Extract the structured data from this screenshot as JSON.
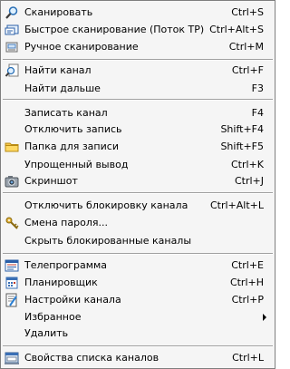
{
  "menu": {
    "scan": {
      "label": "Сканировать",
      "shortcut": "Ctrl+S",
      "icon": "magnifier-icon"
    },
    "quick_scan": {
      "label": "Быстрое сканирование (Поток ТР)",
      "shortcut": "Ctrl+Alt+S",
      "icon": "quick-scan-icon"
    },
    "manual_scan": {
      "label": "Ручное сканирование",
      "shortcut": "Ctrl+M",
      "icon": "manual-scan-icon"
    },
    "find_channel": {
      "label": "Найти канал",
      "shortcut": "Ctrl+F",
      "icon": "find-channel-icon"
    },
    "find_next": {
      "label": "Найти дальше",
      "shortcut": "F3"
    },
    "record_channel": {
      "label": "Записать канал",
      "shortcut": "F4"
    },
    "stop_record": {
      "label": "Отключить запись",
      "shortcut": "Shift+F4"
    },
    "record_folder": {
      "label": "Папка для записи",
      "shortcut": "Shift+F5",
      "icon": "folder-icon"
    },
    "simple_output": {
      "label": "Упрощенный вывод",
      "shortcut": "Ctrl+K"
    },
    "screenshot": {
      "label": "Скриншот",
      "shortcut": "Ctrl+J",
      "icon": "camera-icon"
    },
    "disable_lock": {
      "label": "Отключить блокировку канала",
      "shortcut": "Ctrl+Alt+L"
    },
    "change_password": {
      "label": "Смена пароля...",
      "icon": "keys-icon"
    },
    "hide_blocked": {
      "label": "Скрыть блокированные каналы"
    },
    "tv_program": {
      "label": "Телепрограмма",
      "shortcut": "Ctrl+E",
      "icon": "tv-program-icon"
    },
    "scheduler": {
      "label": "Планировщик",
      "shortcut": "Ctrl+H",
      "icon": "scheduler-icon"
    },
    "channel_settings": {
      "label": "Настройки канала",
      "shortcut": "Ctrl+P",
      "icon": "channel-settings-icon"
    },
    "favorites": {
      "label": "Избранное"
    },
    "delete": {
      "label": "Удалить"
    },
    "list_properties": {
      "label": "Свойства списка каналов",
      "shortcut": "Ctrl+L",
      "icon": "list-properties-icon"
    }
  }
}
